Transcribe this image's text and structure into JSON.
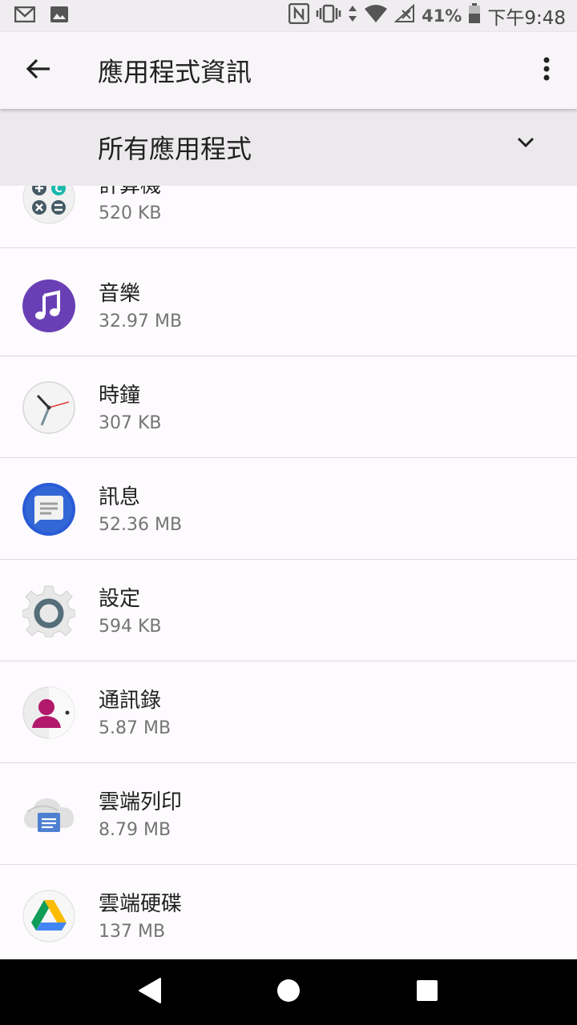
{
  "status_bar": {
    "battery": "41%",
    "time": "下午9:48",
    "icons": [
      "gmail-icon",
      "gallery-icon",
      "nfc-icon",
      "vibrate-icon",
      "data-arrows-icon",
      "wifi-icon",
      "cell-signal-icon",
      "battery-icon"
    ]
  },
  "app_bar": {
    "title": "應用程式資訊",
    "back_icon": "arrow-left-icon",
    "more_icon": "more-vert-icon"
  },
  "filter": {
    "label": "所有應用程式",
    "icon": "chevron-down-icon"
  },
  "apps": [
    {
      "name": "計算機",
      "size": "520 KB",
      "icon": "calculator-icon"
    },
    {
      "name": "音樂",
      "size": "32.97 MB",
      "icon": "music-icon"
    },
    {
      "name": "時鐘",
      "size": "307 KB",
      "icon": "clock-icon"
    },
    {
      "name": "訊息",
      "size": "52.36 MB",
      "icon": "messages-icon"
    },
    {
      "name": "設定",
      "size": "594 KB",
      "icon": "settings-icon"
    },
    {
      "name": "通訊錄",
      "size": "5.87 MB",
      "icon": "contacts-icon"
    },
    {
      "name": "雲端列印",
      "size": "8.79 MB",
      "icon": "cloud-print-icon"
    },
    {
      "name": "雲端硬碟",
      "size": "137 MB",
      "icon": "drive-icon"
    }
  ],
  "nav_bar": {
    "icons": [
      "nav-back-icon",
      "nav-home-icon",
      "nav-recents-icon"
    ]
  },
  "colors": {
    "background": "#fdfbfd",
    "app_bar": "#f7f5f7",
    "filter_bar": "#ebe9eb",
    "music_purple": "#6a3fb5",
    "messages_blue": "#2a5bd7"
  }
}
